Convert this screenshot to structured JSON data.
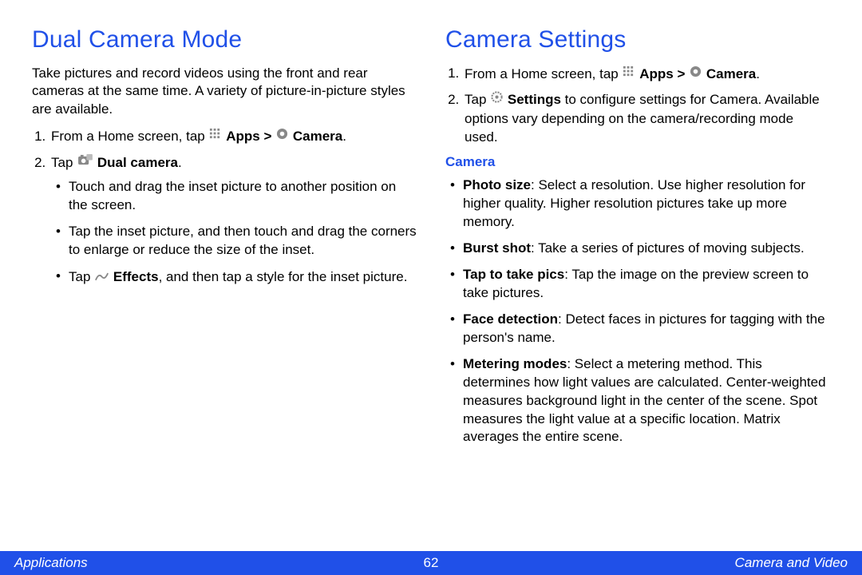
{
  "left": {
    "heading": "Dual Camera Mode",
    "intro": "Take pictures and record videos using the front and rear cameras at the same time. A variety of picture-in-picture styles are available.",
    "step1_pre": "From a Home screen, tap ",
    "apps_label": "Apps",
    "gt": ">",
    "camera_label": "Camera",
    "period": ".",
    "step2_pre": "Tap ",
    "dual_camera_label": "Dual camera",
    "bullet1": "Touch and drag the inset picture to another position on the screen.",
    "bullet2": "Tap the inset picture, and then touch and drag the corners to enlarge or reduce the size of the inset.",
    "bullet3_pre": "Tap ",
    "effects_label": "Effects",
    "bullet3_post": ", and then tap a style for the inset picture."
  },
  "right": {
    "heading": "Camera Settings",
    "step1_pre": "From a Home screen, tap ",
    "apps_label": "Apps",
    "gt": ">",
    "camera_label": "Camera",
    "period": ".",
    "step2_pre": "Tap ",
    "settings_label": "Settings",
    "step2_post": " to configure settings for Camera. Available options vary depending on the camera/recording mode used.",
    "subhead": "Camera",
    "items": [
      {
        "term": "Photo size",
        "desc": ": Select a resolution. Use higher resolution for higher quality. Higher resolution pictures take up more memory."
      },
      {
        "term": "Burst shot",
        "desc": ": Take a series of pictures of moving subjects."
      },
      {
        "term": "Tap to take pics",
        "desc": ": Tap the image on the preview screen to take pictures."
      },
      {
        "term": "Face detection",
        "desc": ": Detect faces in pictures for tagging with the person's name."
      },
      {
        "term": "Metering modes",
        "desc": ": Select a metering method. This determines how light values are calculated. Center-weighted measures background light in the center of the scene. Spot measures the light value at a specific location. Matrix averages the entire scene."
      }
    ]
  },
  "footer": {
    "left": "Applications",
    "center": "62",
    "right": "Camera and Video"
  }
}
